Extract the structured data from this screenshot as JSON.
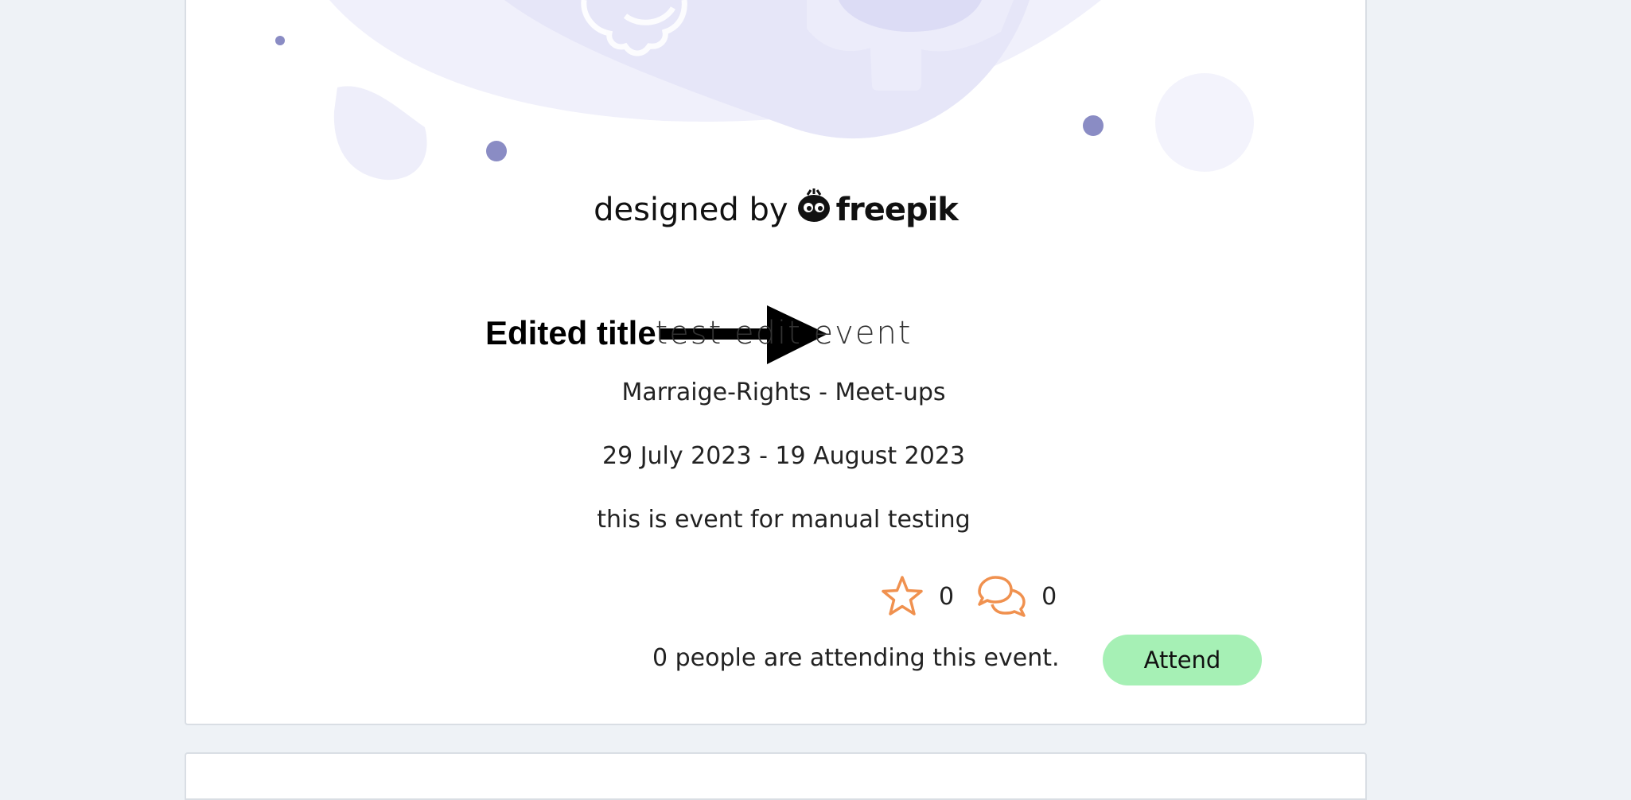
{
  "attribution": {
    "prefix": "designed by",
    "brand": "freepik"
  },
  "annotation": {
    "label": "Edited title"
  },
  "event": {
    "title": "test edit event",
    "category": "Marraige-Rights - Meet-ups",
    "dates": "29 July 2023 - 19 August 2023",
    "description": "this is event for manual testing",
    "stars": "0",
    "comments": "0",
    "attending_text": "0 people are attending this event.",
    "attend_label": "Attend"
  },
  "icons": {
    "star": "star-icon",
    "comments": "comments-icon",
    "freepik_logo": "freepik-logo-icon",
    "arrow": "arrow-icon"
  },
  "colors": {
    "accent_orange": "#f0914f",
    "attend_green": "#a6f0b5",
    "illustration_lavender": "#e6e6f8",
    "dot_purple": "#8a8cc4",
    "dot_pink": "#f0c0cc"
  }
}
